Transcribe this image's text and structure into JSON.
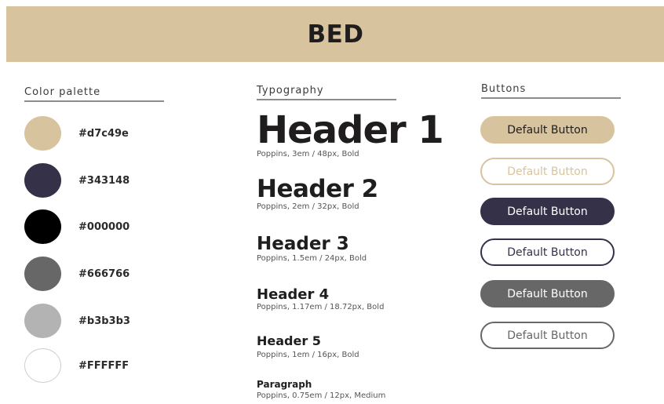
{
  "banner": {
    "title": "BED"
  },
  "palette": {
    "heading": "Color palette",
    "swatches": [
      {
        "hex": "#d7c49e",
        "label": "#d7c49e",
        "border": "#d7c49e"
      },
      {
        "hex": "#343148",
        "label": "#343148",
        "border": "#343148"
      },
      {
        "hex": "#000000",
        "label": "#000000",
        "border": "#000000"
      },
      {
        "hex": "#666766",
        "label": "#666766",
        "border": "#666766"
      },
      {
        "hex": "#b3b3b3",
        "label": "#b3b3b3",
        "border": "#b3b3b3"
      },
      {
        "hex": "#FFFFFF",
        "label": "#FFFFFF",
        "border": "#cfcfcf"
      }
    ]
  },
  "typography": {
    "heading": "Typography",
    "items": [
      {
        "sample": "Header 1",
        "meta": "Poppins, 3em / 48px, Bold"
      },
      {
        "sample": "Header 2",
        "meta": "Poppins, 2em / 32px, Bold"
      },
      {
        "sample": "Header 3",
        "meta": "Poppins, 1.5em / 24px, Bold"
      },
      {
        "sample": "Header 4",
        "meta": "Poppins, 1.17em / 18.72px, Bold"
      },
      {
        "sample": "Header 5",
        "meta": "Poppins, 1em / 16px, Bold"
      },
      {
        "sample": "Paragraph",
        "meta": "Poppins, 0.75em / 12px, Medium"
      }
    ]
  },
  "buttons": {
    "heading": "Buttons",
    "items": [
      {
        "label": "Default Button",
        "fill": "#d7c49e",
        "border": "#d7c49e",
        "text": "#1f1d1e"
      },
      {
        "label": "Default Button",
        "fill": "#ffffff",
        "border": "#d7c49e",
        "text": "#d7c49e"
      },
      {
        "label": "Default Button",
        "fill": "#343148",
        "border": "#343148",
        "text": "#ffffff"
      },
      {
        "label": "Default Button",
        "fill": "#ffffff",
        "border": "#343148",
        "text": "#343148"
      },
      {
        "label": "Default Button",
        "fill": "#666766",
        "border": "#666766",
        "text": "#ffffff"
      },
      {
        "label": "Default Button",
        "fill": "#ffffff",
        "border": "#666766",
        "text": "#666766"
      }
    ]
  }
}
